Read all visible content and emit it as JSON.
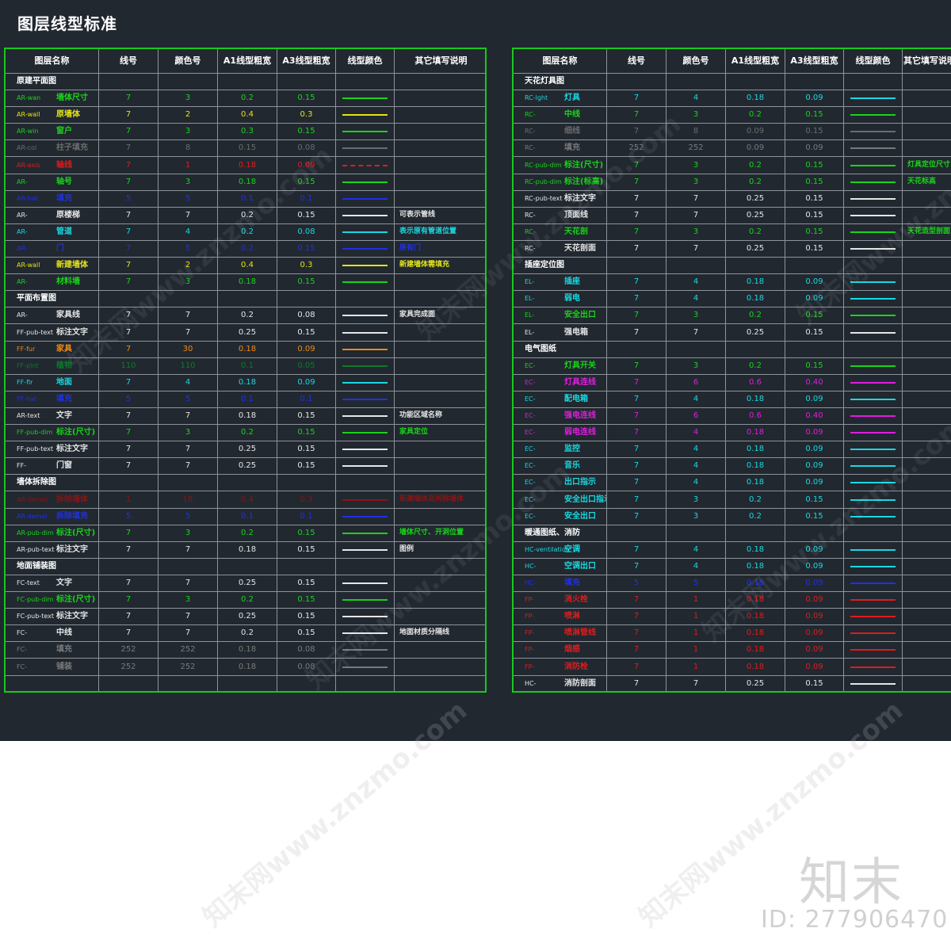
{
  "page": {
    "title": "图层线型标准",
    "brand": "知末",
    "image_id": "ID: 277906470",
    "watermark": "知末网www.znzmo.com"
  },
  "headers": [
    "图层名称",
    "线号",
    "颜色号",
    "A1线型粗宽",
    "A3线型粗宽",
    "线型颜色",
    "其它填写说明"
  ],
  "left_table": [
    {
      "section": "原建平面图"
    },
    {
      "code": "AR-wan",
      "label": "墙体尺寸",
      "num": "7",
      "color_no": "3",
      "a1": "0.2",
      "a3": "0.15",
      "color": "#19d419",
      "note": ""
    },
    {
      "code": "AR-wall",
      "label": "原墙体",
      "num": "7",
      "color_no": "2",
      "a1": "0.4",
      "a3": "0.3",
      "color": "#e2e21a",
      "note": ""
    },
    {
      "code": "AR-win",
      "label": "窗户",
      "num": "7",
      "color_no": "3",
      "a1": "0.3",
      "a3": "0.15",
      "color": "#19d419",
      "note": ""
    },
    {
      "code": "AR-col",
      "label": "柱子填充",
      "num": "7",
      "color_no": "8",
      "a1": "0.15",
      "a3": "0.08",
      "color": "#6c6c6c",
      "note": ""
    },
    {
      "code": "AR-axis",
      "label": "轴线",
      "num": "7",
      "color_no": "1",
      "a1": "0.18",
      "a3": "0.09",
      "color": "#e01c1c",
      "note": "",
      "dashed": true
    },
    {
      "code": "AR-",
      "label": "轴号",
      "num": "7",
      "color_no": "3",
      "a1": "0.18",
      "a3": "0.15",
      "color": "#19d419",
      "note": ""
    },
    {
      "code": "AR-hat",
      "label": "填充",
      "num": "5",
      "color_no": "5",
      "a1": "0.1",
      "a3": "0.1",
      "color": "#2030e8",
      "note": ""
    },
    {
      "code": "AR-",
      "label": "原楼梯",
      "num": "7",
      "color_no": "7",
      "a1": "0.2",
      "a3": "0.15",
      "color": "#e6e6e6",
      "note": "可表示管线"
    },
    {
      "code": "AR-",
      "label": "管道",
      "num": "7",
      "color_no": "4",
      "a1": "0.2",
      "a3": "0.08",
      "color": "#1ad8e0",
      "note": "表示原有管道位置"
    },
    {
      "code": "AR-",
      "label": "门",
      "num": "7",
      "color_no": "5",
      "a1": "0.2",
      "a3": "0.15",
      "color": "#2030e8",
      "note": "原有门"
    },
    {
      "code": "AR-wall",
      "label": "新建墙体",
      "num": "7",
      "color_no": "2",
      "a1": "0.4",
      "a3": "0.3",
      "color": "#e2e21a",
      "note": "新建墙体需填充"
    },
    {
      "code": "AR-",
      "label": "材料墙",
      "num": "7",
      "color_no": "3",
      "a1": "0.18",
      "a3": "0.15",
      "color": "#19d419",
      "note": ""
    },
    {
      "section": "平面布置图"
    },
    {
      "code": "AR-",
      "label": "家具线",
      "num": "7",
      "color_no": "7",
      "a1": "0.2",
      "a3": "0.08",
      "color": "#e6e6e6",
      "note": "家具完成面"
    },
    {
      "code": "FF-pub-text",
      "label": "标注文字",
      "num": "7",
      "color_no": "7",
      "a1": "0.25",
      "a3": "0.15",
      "color": "#e6e6e6",
      "note": ""
    },
    {
      "code": "FF-fur",
      "label": "家具",
      "num": "7",
      "color_no": "30",
      "a1": "0.18",
      "a3": "0.09",
      "color": "#f08a14",
      "note": ""
    },
    {
      "code": "FF-plnt",
      "label": "植物",
      "num": "110",
      "color_no": "110",
      "a1": "0.1",
      "a3": "0.05",
      "color": "#0e7a2a",
      "note": ""
    },
    {
      "code": "FF-flr",
      "label": "地面",
      "num": "7",
      "color_no": "4",
      "a1": "0.18",
      "a3": "0.09",
      "color": "#1ad8e0",
      "note": ""
    },
    {
      "code": "FF-hat",
      "label": "填充",
      "num": "5",
      "color_no": "5",
      "a1": "0.1",
      "a3": "0.1",
      "color": "#2030e8",
      "note": ""
    },
    {
      "code": "AR-text",
      "label": "文字",
      "num": "7",
      "color_no": "7",
      "a1": "0.18",
      "a3": "0.15",
      "color": "#e6e6e6",
      "note": "功能区域名称"
    },
    {
      "code": "FF-pub-dim",
      "label": "标注(尺寸)",
      "num": "7",
      "color_no": "3",
      "a1": "0.2",
      "a3": "0.15",
      "color": "#19d419",
      "note": "家具定位"
    },
    {
      "code": "FF-pub-text",
      "label": "标注文字",
      "num": "7",
      "color_no": "7",
      "a1": "0.25",
      "a3": "0.15",
      "color": "#e6e6e6",
      "note": ""
    },
    {
      "code": "FF-",
      "label": "门窗",
      "num": "7",
      "color_no": "7",
      "a1": "0.25",
      "a3": "0.15",
      "color": "#e6e6e6",
      "note": ""
    },
    {
      "section": "墙体拆除图"
    },
    {
      "code": "AR-demol",
      "label": "拆除墙体",
      "num": "1",
      "color_no": "18",
      "a1": "0.4",
      "a3": "0.3",
      "color": "#8a1414",
      "note": "新建墙体及拆除墙体"
    },
    {
      "code": "AR-demol",
      "label": "拆除填充",
      "num": "5",
      "color_no": "5",
      "a1": "0.1",
      "a3": "0.1",
      "color": "#2030e8",
      "note": ""
    },
    {
      "code": "AR-pub-dim",
      "label": "标注(尺寸)",
      "num": "7",
      "color_no": "3",
      "a1": "0.2",
      "a3": "0.15",
      "color": "#19d419",
      "note": "墙体尺寸、开洞位置"
    },
    {
      "code": "AR-pub-text",
      "label": "标注文字",
      "num": "7",
      "color_no": "7",
      "a1": "0.18",
      "a3": "0.15",
      "color": "#e6e6e6",
      "note": "图例"
    },
    {
      "section": "地面铺装图"
    },
    {
      "code": "FC-text",
      "label": "文字",
      "num": "7",
      "color_no": "7",
      "a1": "0.25",
      "a3": "0.15",
      "color": "#e6e6e6",
      "note": ""
    },
    {
      "code": "FC-pub-dim",
      "label": "标注(尺寸)",
      "num": "7",
      "color_no": "3",
      "a1": "0.2",
      "a3": "0.15",
      "color": "#19d419",
      "note": ""
    },
    {
      "code": "FC-pub-text",
      "label": "标注文字",
      "num": "7",
      "color_no": "7",
      "a1": "0.25",
      "a3": "0.15",
      "color": "#e6e6e6",
      "note": ""
    },
    {
      "code": "FC-",
      "label": "中线",
      "num": "7",
      "color_no": "7",
      "a1": "0.2",
      "a3": "0.15",
      "color": "#e6e6e6",
      "note": "地面材质分隔线"
    },
    {
      "code": "FC-",
      "label": "填充",
      "num": "252",
      "color_no": "252",
      "a1": "0.18",
      "a3": "0.08",
      "color": "#7a7a7a",
      "note": ""
    },
    {
      "code": "FC-",
      "label": "铺装",
      "num": "252",
      "color_no": "252",
      "a1": "0.18",
      "a3": "0.08",
      "color": "#7a7a7a",
      "note": ""
    },
    {
      "blank": true
    }
  ],
  "right_table": [
    {
      "section": "天花灯具图"
    },
    {
      "code": "RC-lght",
      "label": "灯具",
      "num": "7",
      "color_no": "4",
      "a1": "0.18",
      "a3": "0.09",
      "color": "#1ad8e0",
      "note": ""
    },
    {
      "code": "RC-",
      "label": "中线",
      "num": "7",
      "color_no": "3",
      "a1": "0.2",
      "a3": "0.15",
      "color": "#19d419",
      "note": ""
    },
    {
      "code": "RC-",
      "label": "细线",
      "num": "7",
      "color_no": "8",
      "a1": "0.09",
      "a3": "0.15",
      "color": "#6c6c6c",
      "note": ""
    },
    {
      "code": "RC-",
      "label": "填充",
      "num": "252",
      "color_no": "252",
      "a1": "0.09",
      "a3": "0.09",
      "color": "#7a7a7a",
      "note": ""
    },
    {
      "code": "RC-pub-dim",
      "label": "标注(尺寸)",
      "num": "7",
      "color_no": "3",
      "a1": "0.2",
      "a3": "0.15",
      "color": "#19d419",
      "note": "灯具定位尺寸"
    },
    {
      "code": "RC-pub-dim",
      "label": "标注(标高)",
      "num": "7",
      "color_no": "3",
      "a1": "0.2",
      "a3": "0.15",
      "color": "#19d419",
      "note": "天花标高"
    },
    {
      "code": "RC-pub-text",
      "label": "标注文字",
      "num": "7",
      "color_no": "7",
      "a1": "0.25",
      "a3": "0.15",
      "color": "#e6e6e6",
      "note": ""
    },
    {
      "code": "RC-",
      "label": "顶面线",
      "num": "7",
      "color_no": "7",
      "a1": "0.25",
      "a3": "0.15",
      "color": "#e6e6e6",
      "note": ""
    },
    {
      "code": "RC-",
      "label": "天花剖",
      "num": "7",
      "color_no": "3",
      "a1": "0.2",
      "a3": "0.15",
      "color": "#19d419",
      "note": "天花造型剖面"
    },
    {
      "code": "RC-",
      "label": "天花剖面",
      "num": "7",
      "color_no": "7",
      "a1": "0.25",
      "a3": "0.15",
      "color": "#e6e6e6",
      "note": ""
    },
    {
      "section": "插座定位图"
    },
    {
      "code": "EL-",
      "label": "插座",
      "num": "7",
      "color_no": "4",
      "a1": "0.18",
      "a3": "0.09",
      "color": "#1ad8e0",
      "note": ""
    },
    {
      "code": "EL-",
      "label": "弱电",
      "num": "7",
      "color_no": "4",
      "a1": "0.18",
      "a3": "0.09",
      "color": "#1ad8e0",
      "note": ""
    },
    {
      "code": "EL-",
      "label": "安全出口",
      "num": "7",
      "color_no": "3",
      "a1": "0.2",
      "a3": "0.15",
      "color": "#19d419",
      "note": ""
    },
    {
      "code": "EL-",
      "label": "强电箱",
      "num": "7",
      "color_no": "7",
      "a1": "0.25",
      "a3": "0.15",
      "color": "#e6e6e6",
      "note": ""
    },
    {
      "section": "电气图纸"
    },
    {
      "code": "EC-",
      "label": "灯具开关",
      "num": "7",
      "color_no": "3",
      "a1": "0.2",
      "a3": "0.15",
      "color": "#19d419",
      "note": ""
    },
    {
      "code": "EC-",
      "label": "灯具连线",
      "num": "7",
      "color_no": "6",
      "a1": "0.6",
      "a3": "0.40",
      "color": "#e01ce0",
      "note": ""
    },
    {
      "code": "EC-",
      "label": "配电箱",
      "num": "7",
      "color_no": "4",
      "a1": "0.18",
      "a3": "0.09",
      "color": "#1ad8e0",
      "note": ""
    },
    {
      "code": "EC-",
      "label": "强电连线",
      "num": "7",
      "color_no": "6",
      "a1": "0.6",
      "a3": "0.40",
      "color": "#e01ce0",
      "note": ""
    },
    {
      "code": "EC-",
      "label": "弱电连线",
      "num": "7",
      "color_no": "4",
      "a1": "0.18",
      "a3": "0.09",
      "color": "#e01ce0",
      "note": ""
    },
    {
      "code": "EC-",
      "label": "监控",
      "num": "7",
      "color_no": "4",
      "a1": "0.18",
      "a3": "0.09",
      "color": "#1ad8e0",
      "note": ""
    },
    {
      "code": "EC-",
      "label": "音乐",
      "num": "7",
      "color_no": "4",
      "a1": "0.18",
      "a3": "0.09",
      "color": "#1ad8e0",
      "note": ""
    },
    {
      "code": "EC-",
      "label": "出口指示",
      "num": "7",
      "color_no": "4",
      "a1": "0.18",
      "a3": "0.09",
      "color": "#1ad8e0",
      "note": ""
    },
    {
      "code": "EC-",
      "label": "安全出口指示",
      "num": "7",
      "color_no": "3",
      "a1": "0.2",
      "a3": "0.15",
      "color": "#1ad8e0",
      "note": ""
    },
    {
      "code": "EC-",
      "label": "安全出口",
      "num": "7",
      "color_no": "3",
      "a1": "0.2",
      "a3": "0.15",
      "color": "#1ad8e0",
      "note": ""
    },
    {
      "section": "暖通图纸、消防"
    },
    {
      "code": "HC-ventilation",
      "label": "空调",
      "num": "7",
      "color_no": "4",
      "a1": "0.18",
      "a3": "0.09",
      "color": "#1ad8e0",
      "note": ""
    },
    {
      "code": "HC-",
      "label": "空调出口",
      "num": "7",
      "color_no": "4",
      "a1": "0.18",
      "a3": "0.09",
      "color": "#1ad8e0",
      "note": ""
    },
    {
      "code": "HC-",
      "label": "填充",
      "num": "5",
      "color_no": "5",
      "a1": "0.18",
      "a3": "0.09",
      "color": "#2030e8",
      "note": ""
    },
    {
      "code": "FP-",
      "label": "消火栓",
      "num": "7",
      "color_no": "1",
      "a1": "0.18",
      "a3": "0.09",
      "color": "#e01c1c",
      "note": ""
    },
    {
      "code": "FP-",
      "label": "喷淋",
      "num": "7",
      "color_no": "1",
      "a1": "0.18",
      "a3": "0.09",
      "color": "#e01c1c",
      "note": ""
    },
    {
      "code": "FP-",
      "label": "喷淋管线",
      "num": "7",
      "color_no": "1",
      "a1": "0.18",
      "a3": "0.09",
      "color": "#e01c1c",
      "note": ""
    },
    {
      "code": "FP-",
      "label": "烟感",
      "num": "7",
      "color_no": "1",
      "a1": "0.18",
      "a3": "0.09",
      "color": "#e01c1c",
      "note": ""
    },
    {
      "code": "FP-",
      "label": "消防栓",
      "num": "7",
      "color_no": "1",
      "a1": "0.18",
      "a3": "0.09",
      "color": "#e01c1c",
      "note": ""
    },
    {
      "code": "HC-",
      "label": "消防剖面",
      "num": "7",
      "color_no": "7",
      "a1": "0.25",
      "a3": "0.15",
      "color": "#e6e6e6",
      "note": ""
    }
  ]
}
